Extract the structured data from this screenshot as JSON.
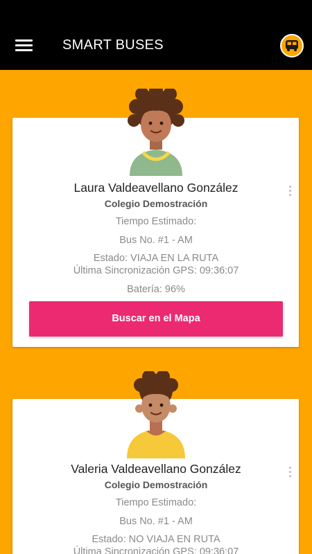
{
  "app": {
    "title": "SMART BUSES",
    "accent_color": "#FFA500",
    "bar_color": "#000000",
    "button_color": "#EC2A71",
    "icons": {
      "menu": "hamburger-menu-icon",
      "bus": "school-bus-icon",
      "more": "more-vert-icon"
    }
  },
  "students": [
    {
      "name": "Laura Valdeavellano González",
      "school": "Colegio Demostración",
      "estimated_time": "Tiempo Estimado:",
      "bus": "Bus No. #1 - AM",
      "status": "Estado: VIAJA EN LA RUTA",
      "gps_sync": "Última Sincronización GPS: 09:36:07",
      "battery": "Batería: 96%",
      "map_button": "Buscar en el Mapa"
    },
    {
      "name": "Valeria Valdeavellano González",
      "school": "Colegio Demostración",
      "estimated_time": "Tiempo Estimado:",
      "bus": "Bus No. #1 - AM",
      "status": "Estado: NO VIAJA EN RUTA",
      "gps_sync": "Última Sincronización GPS: 09:36:07"
    }
  ]
}
